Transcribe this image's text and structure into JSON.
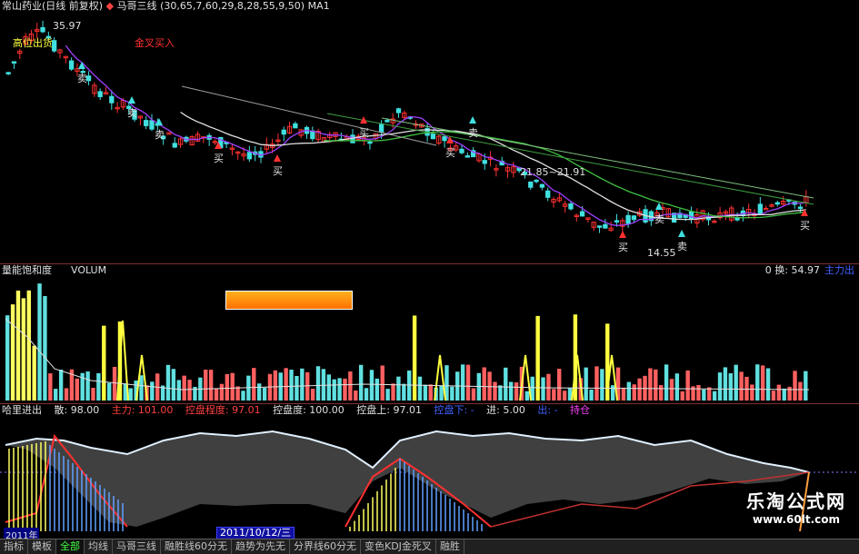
{
  "main_header": {
    "stock": "常山药业(日线 前复权)",
    "indicator": "马哥三线",
    "params": "(30,65,7,60,29,8,28,55,9,50)",
    "ma": "MA1"
  },
  "main_chart": {
    "high_label": "35.97",
    "top_left_label": "高位出货",
    "signal_label": "金叉买入",
    "mid_label": "21.85~21.91",
    "low_label": "14.55",
    "buy_label": "买",
    "sell_label": "卖",
    "colors": {
      "up": "#ff3030",
      "down": "#40e0e0",
      "ma1": "#a040ff",
      "ma2": "#e0e0e0",
      "ma3": "#40c040"
    }
  },
  "volume_header": {
    "left": "量能饱和度",
    "name": "VOLUM",
    "right_value": "0 换: 54.97",
    "right_tag": "主力出"
  },
  "control_header": {
    "left": "哈里进出",
    "items": [
      {
        "label": "散: 98.00",
        "color": "#e0e0e0"
      },
      {
        "label": "主力: 101.00",
        "color": "#ff4040"
      },
      {
        "label": "控盘程度: 97.01",
        "color": "#ff4040"
      },
      {
        "label": "控盘度: 100.00",
        "color": "#e0e0e0"
      },
      {
        "label": "控盘上: 97.01",
        "color": "#e0e0e0"
      },
      {
        "label": "控盘下: -",
        "color": "#4060ff"
      },
      {
        "label": "进: 5.00",
        "color": "#e0e0e0"
      },
      {
        "label": "出: -",
        "color": "#4060ff"
      },
      {
        "label": "持仓",
        "color": "#ff40ff"
      }
    ]
  },
  "date_cursor": "2011/10/12/三",
  "left_date": "2011年",
  "tabs": [
    "指标",
    "模板",
    "全部",
    "均线",
    "马哥三线",
    "融胜线60分无",
    "趋势为先无",
    "分界线60分无",
    "变色KDJ金死叉",
    "融胜"
  ],
  "active_tab": 2,
  "watermark": {
    "title": "乐淘公式网",
    "url": "www.60lt.com"
  }
}
